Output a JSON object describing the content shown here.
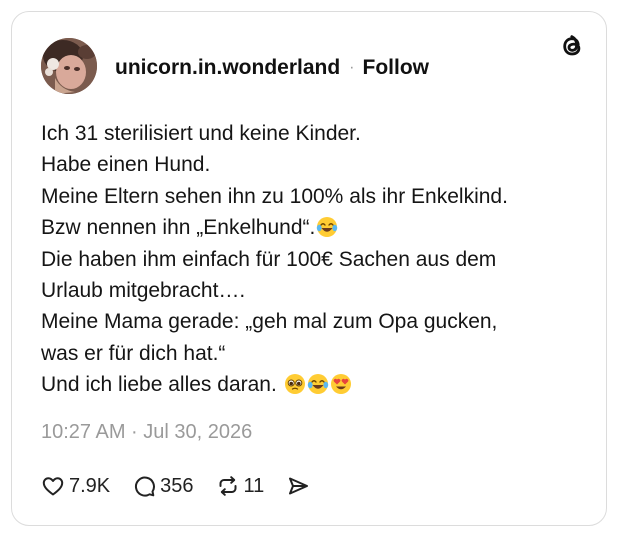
{
  "post": {
    "username": "unicorn.in.wonderland",
    "separator": "·",
    "follow_label": "Follow",
    "lines": [
      "Ich 31 sterilisiert und keine Kinder.",
      "Habe einen Hund.",
      "Meine Eltern sehen ihn zu 100% als ihr Enkelkind.",
      "Bzw nennen ihn „Enkelhund“.",
      "Die haben ihm einfach für 100€ Sachen aus dem",
      "Urlaub mitgebracht….",
      "Meine Mama gerade: „geh mal zum Opa gucken,",
      "was er für dich hat.“",
      "Und ich liebe alles daran."
    ],
    "emojis": {
      "line4": [
        "face-with-tears-of-joy"
      ],
      "line9": [
        "pleading-face",
        "face-with-tears-of-joy",
        "smiling-face-with-heart-eyes"
      ]
    },
    "timestamp": "10:27 AM · Jul 30, 2026"
  },
  "actions": {
    "likes": "7.9K",
    "replies": "356",
    "reposts": "11"
  },
  "icons": {
    "logo": "threads-logo-icon",
    "like": "heart-icon",
    "reply": "comment-bubble-icon",
    "repost": "repost-icon",
    "share": "send-icon"
  },
  "colors": {
    "text": "#111111",
    "muted": "#9a9a9a",
    "border": "#dcdcdc",
    "emoji_yellow": "#ffcc33",
    "heart_red": "#e8453c"
  }
}
